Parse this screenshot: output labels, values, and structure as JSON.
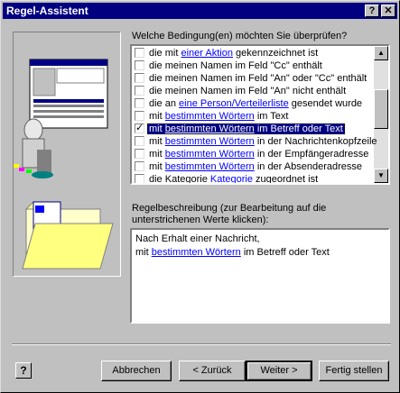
{
  "window": {
    "title": "Regel-Assistent",
    "help_btn": "?",
    "close_btn": "✕"
  },
  "prompt": "Welche Bedingung(en) möchten Sie überprüfen?",
  "conditions": [
    {
      "pre": "die mit ",
      "link": "einer Aktion",
      "post": " gekennzeichnet ist",
      "checked": false,
      "selected": false
    },
    {
      "pre": "die meinen Namen im Feld \"Cc\" enthält",
      "link": "",
      "post": "",
      "checked": false,
      "selected": false
    },
    {
      "pre": "die meinen Namen im Feld \"An\" oder \"Cc\" enthält",
      "link": "",
      "post": "",
      "checked": false,
      "selected": false
    },
    {
      "pre": "die meinen Namen im Feld \"An\" nicht enthält",
      "link": "",
      "post": "",
      "checked": false,
      "selected": false
    },
    {
      "pre": "die an ",
      "link": "eine Person/Verteilerliste",
      "post": " gesendet wurde",
      "checked": false,
      "selected": false
    },
    {
      "pre": "mit ",
      "link": "bestimmten Wörtern",
      "post": " im Text",
      "checked": false,
      "selected": false
    },
    {
      "pre": "mit ",
      "link": "bestimmten Wörtern",
      "post": " im Betreff oder Text",
      "checked": true,
      "selected": true
    },
    {
      "pre": "mit ",
      "link": "bestimmten Wörtern",
      "post": " in der Nachrichtenkopfzeile",
      "checked": false,
      "selected": false
    },
    {
      "pre": "mit ",
      "link": "bestimmten Wörtern",
      "post": " in der Empfängeradresse",
      "checked": false,
      "selected": false
    },
    {
      "pre": "mit ",
      "link": "bestimmten Wörtern",
      "post": " in der Absenderadresse",
      "checked": false,
      "selected": false
    },
    {
      "pre": "die Kategorie ",
      "link": "Kategorie",
      "post": " zugeordnet ist",
      "checked": false,
      "selected": false
    }
  ],
  "description_label": {
    "line1": "Regelbeschreibung (zur Bearbeitung auf die",
    "line2": "unterstrichenen Werte klicken):"
  },
  "description": {
    "line1": "Nach Erhalt einer Nachricht,",
    "line2_pre": "mit ",
    "line2_link": "bestimmten Wörtern",
    "line2_post": " im Betreff oder Text"
  },
  "buttons": {
    "help": "?",
    "cancel": "Abbrechen",
    "back": "< Zurück",
    "next": "Weiter >",
    "finish": "Fertig stellen"
  },
  "colors": {
    "titlebar": "#000080",
    "face": "#c0c0c0",
    "selection": "#000080",
    "link": "#0000ff"
  }
}
